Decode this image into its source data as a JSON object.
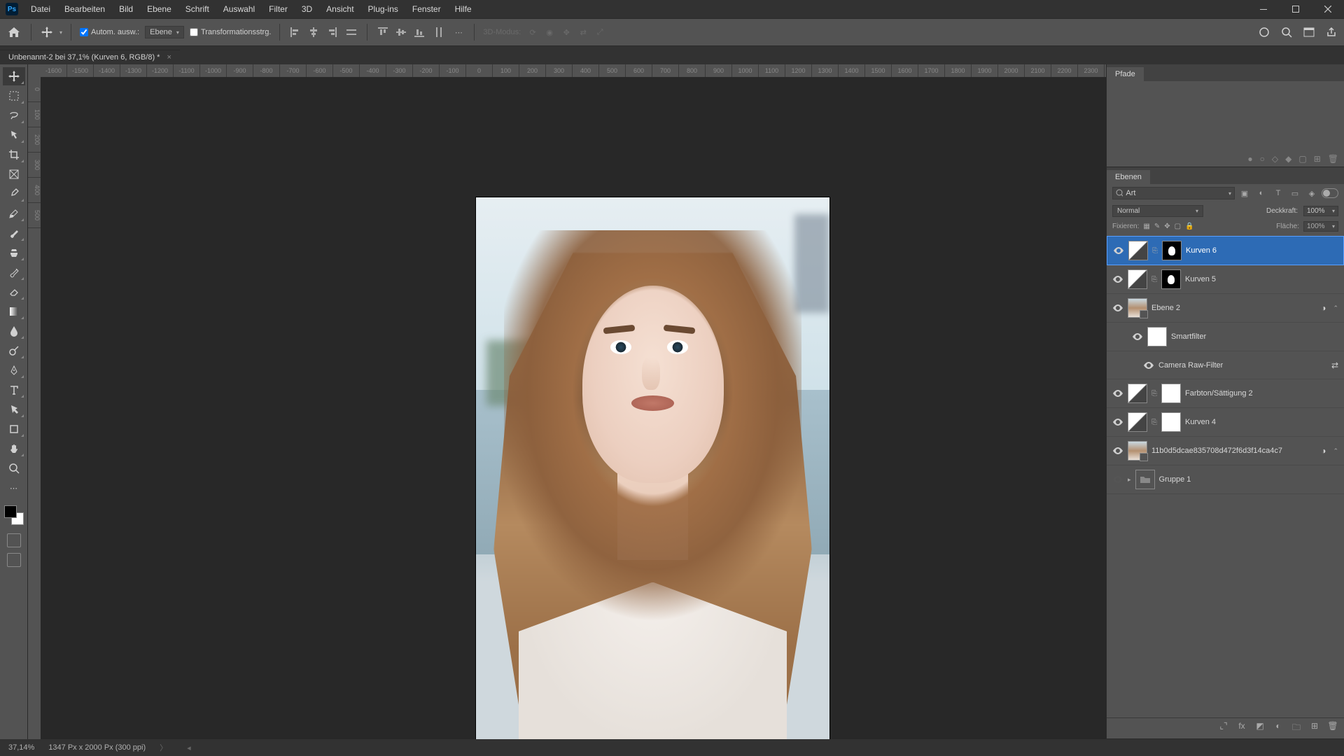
{
  "menu": [
    "Datei",
    "Bearbeiten",
    "Bild",
    "Ebene",
    "Schrift",
    "Auswahl",
    "Filter",
    "3D",
    "Ansicht",
    "Plug-ins",
    "Fenster",
    "Hilfe"
  ],
  "options": {
    "auto_select": "Autom. ausw.:",
    "layer": "Ebene",
    "transform": "Transformationsstrg.",
    "mode3d": "3D-Modus:"
  },
  "doc_tab": "Unbenannt-2 bei 37,1% (Kurven 6, RGB/8) *",
  "ruler_h": [
    "-1600",
    "-1500",
    "-1400",
    "-1300",
    "-1200",
    "-1100",
    "-1000",
    "-900",
    "-800",
    "-700",
    "-600",
    "-500",
    "-400",
    "-300",
    "-200",
    "-100",
    "0",
    "100",
    "200",
    "300",
    "400",
    "500",
    "600",
    "700",
    "800",
    "900",
    "1000",
    "1100",
    "1200",
    "1300",
    "1400",
    "1500",
    "1600",
    "1700",
    "1800",
    "1900",
    "2000",
    "2100",
    "2200",
    "2300"
  ],
  "ruler_v": [
    "0",
    "100",
    "200",
    "300",
    "400",
    "500"
  ],
  "panels": {
    "paths": "Pfade",
    "layers": "Ebenen",
    "search_kind": "Art",
    "blend": "Normal",
    "opacity_label": "Deckkraft:",
    "opacity": "100%",
    "lock_label": "Fixieren:",
    "fill_label": "Fläche:",
    "fill": "100%"
  },
  "layers": [
    {
      "name": "Kurven 6",
      "sel": true,
      "eye": true,
      "curves": true,
      "mask": "b"
    },
    {
      "name": "Kurven 5",
      "eye": true,
      "curves": true,
      "mask": "b"
    },
    {
      "name": "Ebene 2",
      "eye": true,
      "img": true,
      "smart": true
    },
    {
      "name": "Smartfilter",
      "eye": true,
      "mask": "w",
      "child": true
    },
    {
      "name": "Camera Raw-Filter",
      "eye": true,
      "child2": true,
      "fx": true
    },
    {
      "name": "Farbton/Sättigung 2",
      "eye": true,
      "curves": true,
      "mask": "w"
    },
    {
      "name": "Kurven 4",
      "eye": true,
      "curves": true,
      "mask": "w"
    },
    {
      "name": "11b0d5dcae835708d472f6d3f14ca4c7",
      "eye": true,
      "img": true,
      "smart": true
    },
    {
      "name": "Gruppe 1",
      "eye": false,
      "group": true
    }
  ],
  "status": {
    "zoom": "37,14%",
    "size": "1347 Px x 2000 Px (300 ppi)"
  }
}
